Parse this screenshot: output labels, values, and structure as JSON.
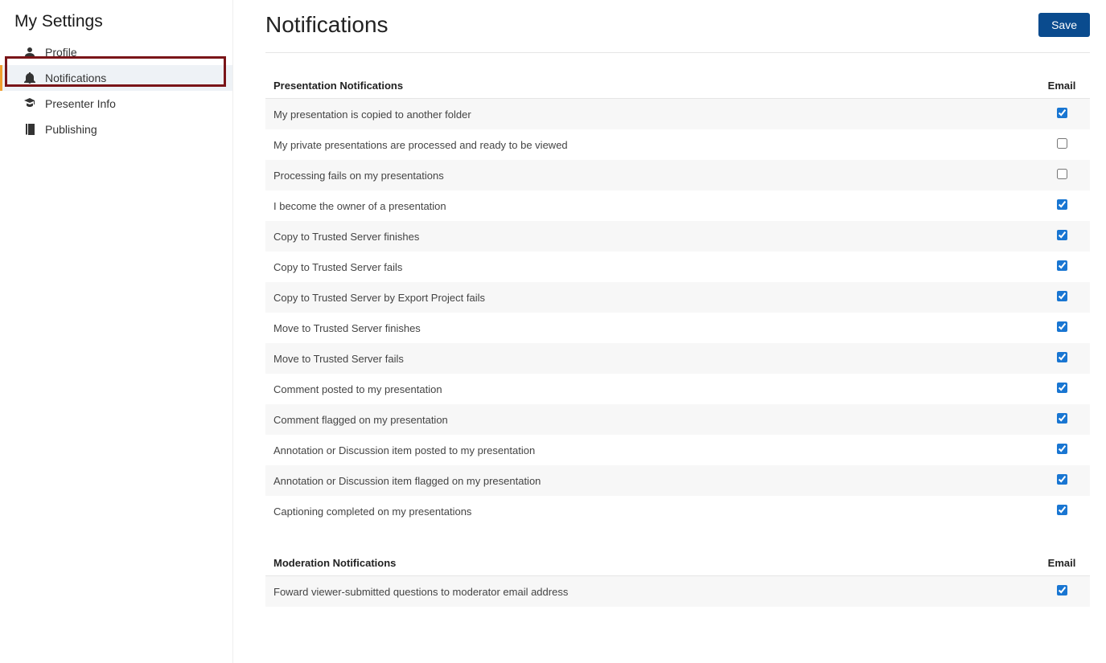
{
  "sidebar": {
    "title": "My Settings",
    "items": [
      {
        "label": "Profile",
        "icon": "person"
      },
      {
        "label": "Notifications",
        "icon": "bell",
        "active": true
      },
      {
        "label": "Presenter Info",
        "icon": "grad-cap"
      },
      {
        "label": "Publishing",
        "icon": "book"
      }
    ]
  },
  "page": {
    "title": "Notifications",
    "save_label": "Save"
  },
  "sections": [
    {
      "title": "Presentation Notifications",
      "column_label": "Email",
      "rows": [
        {
          "label": "My presentation is copied to another folder",
          "checked": true
        },
        {
          "label": "My private presentations are processed and ready to be viewed",
          "checked": false
        },
        {
          "label": "Processing fails on my presentations",
          "checked": false
        },
        {
          "label": "I become the owner of a presentation",
          "checked": true
        },
        {
          "label": "Copy to Trusted Server finishes",
          "checked": true
        },
        {
          "label": "Copy to Trusted Server fails",
          "checked": true
        },
        {
          "label": "Copy to Trusted Server by Export Project fails",
          "checked": true
        },
        {
          "label": "Move to Trusted Server finishes",
          "checked": true
        },
        {
          "label": "Move to Trusted Server fails",
          "checked": true
        },
        {
          "label": "Comment posted to my presentation",
          "checked": true
        },
        {
          "label": "Comment flagged on my presentation",
          "checked": true
        },
        {
          "label": "Annotation or Discussion item posted to my presentation",
          "checked": true
        },
        {
          "label": "Annotation or Discussion item flagged on my presentation",
          "checked": true
        },
        {
          "label": "Captioning completed on my presentations",
          "checked": true
        }
      ]
    },
    {
      "title": "Moderation Notifications",
      "column_label": "Email",
      "rows": [
        {
          "label": "Foward viewer-submitted questions to moderator email address",
          "checked": true
        }
      ]
    }
  ],
  "annotations": {
    "highlight_sidebar_item_index": 1,
    "arrow_target": "first-checkbox"
  }
}
